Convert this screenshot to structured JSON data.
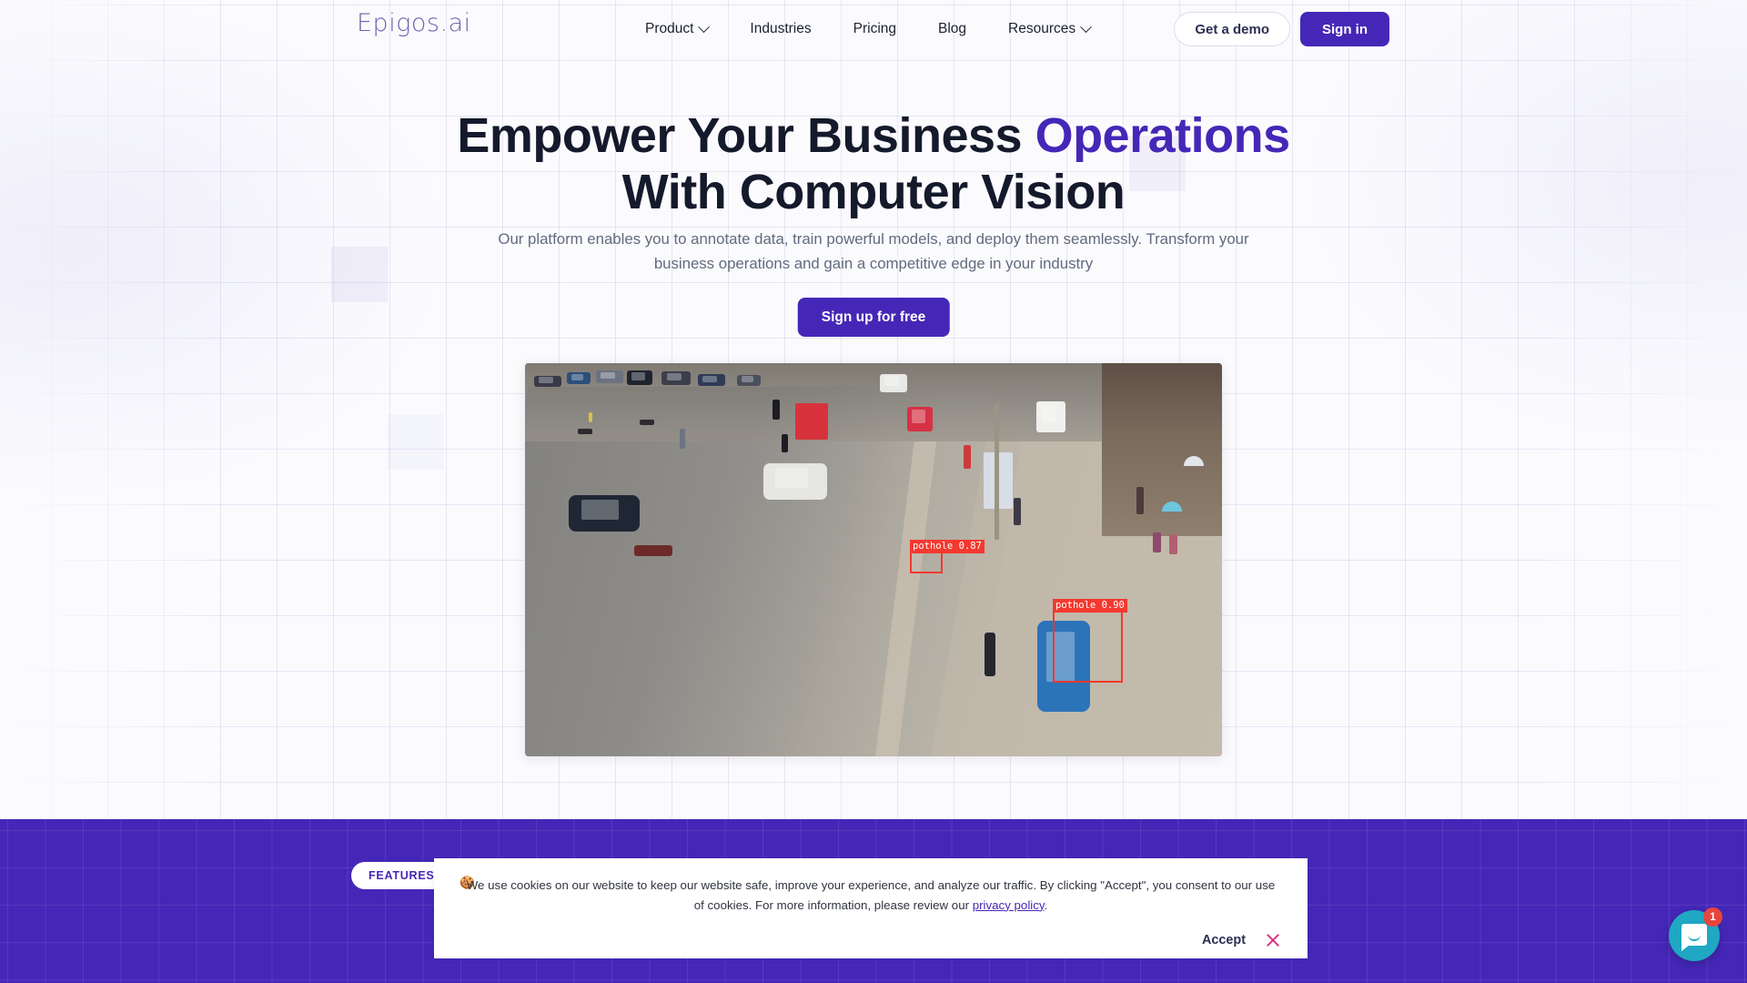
{
  "brand": {
    "logo_text": "Epigos.ai",
    "accent_color": "#4527b7",
    "text_color": "#141a2b"
  },
  "nav": {
    "links": [
      {
        "label": "Product",
        "has_dropdown": true
      },
      {
        "label": "Industries",
        "has_dropdown": false
      },
      {
        "label": "Pricing",
        "has_dropdown": false
      },
      {
        "label": "Blog",
        "has_dropdown": false
      },
      {
        "label": "Resources",
        "has_dropdown": true
      }
    ],
    "demo_label": "Get a demo",
    "signin_label": "Sign in"
  },
  "hero": {
    "headline_part1": "Empower Your Business ",
    "headline_accent": "Operations",
    "headline_part2": "With Computer Vision",
    "subheadline": "Our platform enables you to annotate data, train powerful models, and deploy them seamlessly. Transform your business operations and gain a competitive edge in your industry",
    "cta_label": "Sign up for free",
    "media": {
      "alt": "Aerial traffic camera view of a busy road with pothole detections",
      "detections": [
        {
          "label": "pothole",
          "score": "0.87",
          "box_color": "#f4392f"
        },
        {
          "label": "pothole",
          "score": "0.90",
          "box_color": "#f4392f"
        }
      ]
    }
  },
  "features_section": {
    "badge_label": "FEATURES",
    "background_color": "#4527b7"
  },
  "cookie_banner": {
    "emoji": "🍪",
    "text_before_link": "We use cookies on our website to keep our website safe, improve your experience, and analyze our traffic. By clicking \"Accept\", you consent to our use of cookies. For more information, please review our ",
    "link_label": "privacy policy",
    "text_after_link": ".",
    "accept_label": "Accept",
    "close_icon": "close-icon"
  },
  "chat_widget": {
    "icon": "chat-bubble-icon",
    "unread_count": "1",
    "color": "#1fa7c4",
    "badge_color": "#e8453c"
  }
}
